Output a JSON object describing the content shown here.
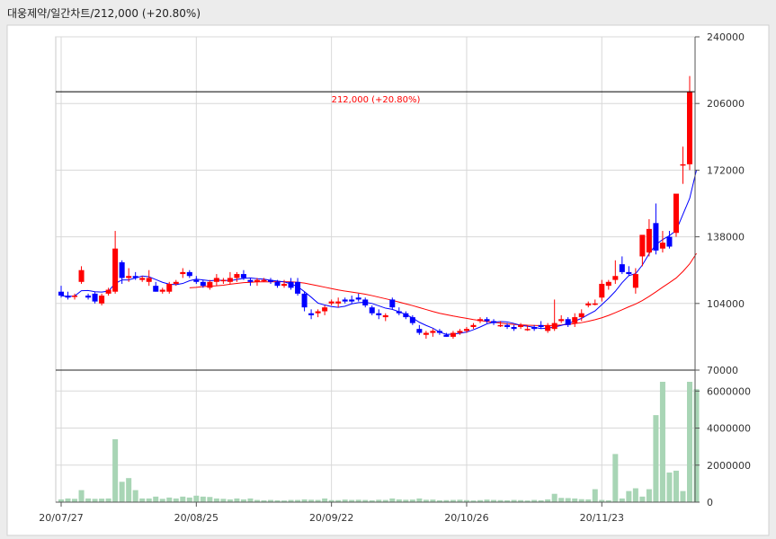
{
  "title": "대웅제약/일간차트/212,000  (+20.80%)",
  "chart_data": [
    {
      "type": "candlestick",
      "name": "price",
      "ylim": [
        70000,
        240000
      ],
      "y_ticks": [
        "240000",
        "206000",
        "172000",
        "138000",
        "104000",
        "70000"
      ],
      "x_ticks": [
        {
          "index": 0,
          "label": "20/07/27"
        },
        {
          "index": 20,
          "label": "20/08/25"
        },
        {
          "index": 40,
          "label": "20/09/22"
        },
        {
          "index": 60,
          "label": "20/10/26"
        },
        {
          "index": 80,
          "label": "20/11/23"
        }
      ],
      "last_price_line": {
        "value": 212000,
        "label": "212,000 (+20.80%)"
      },
      "candles": [
        [
          110000,
          113000,
          107000,
          108000
        ],
        [
          108000,
          110000,
          106000,
          107000
        ],
        [
          108000,
          109000,
          106000,
          108000
        ],
        [
          115000,
          123000,
          114000,
          121000
        ],
        [
          108000,
          109000,
          106000,
          107000
        ],
        [
          109000,
          110000,
          104000,
          105000
        ],
        [
          104000,
          109000,
          103000,
          108000
        ],
        [
          109000,
          112000,
          108000,
          111000
        ],
        [
          110000,
          141000,
          109000,
          132000
        ],
        [
          125000,
          126000,
          114000,
          117000
        ],
        [
          117000,
          122000,
          115000,
          118000
        ],
        [
          118000,
          120000,
          116000,
          117000
        ],
        [
          116000,
          118000,
          115000,
          117000
        ],
        [
          115000,
          121000,
          113000,
          117000
        ],
        [
          113000,
          115000,
          110000,
          110000
        ],
        [
          110000,
          112000,
          109000,
          111000
        ],
        [
          110000,
          115000,
          109000,
          114000
        ],
        [
          114000,
          116000,
          113000,
          115000
        ],
        [
          119000,
          122000,
          117000,
          120000
        ],
        [
          120000,
          121000,
          117000,
          118000
        ],
        [
          116000,
          118000,
          114000,
          115000
        ],
        [
          115000,
          116000,
          112000,
          113000
        ],
        [
          112000,
          116000,
          111000,
          115000
        ],
        [
          115000,
          119000,
          113000,
          117000
        ],
        [
          116000,
          117000,
          114000,
          116000
        ],
        [
          115000,
          120000,
          114000,
          117000
        ],
        [
          117000,
          120000,
          115000,
          119000
        ],
        [
          119000,
          121000,
          116000,
          117000
        ],
        [
          116000,
          117000,
          113000,
          115000
        ],
        [
          115000,
          117000,
          113000,
          116000
        ],
        [
          116000,
          117000,
          115000,
          116000
        ],
        [
          116000,
          117000,
          114000,
          115000
        ],
        [
          115000,
          116000,
          112000,
          113000
        ],
        [
          113000,
          116000,
          112000,
          114000
        ],
        [
          115000,
          117000,
          111000,
          112000
        ],
        [
          115000,
          117000,
          108000,
          109000
        ],
        [
          109000,
          110000,
          100000,
          102000
        ],
        [
          99000,
          101000,
          96000,
          98000
        ],
        [
          99000,
          101000,
          97000,
          100000
        ],
        [
          100000,
          103000,
          98000,
          102000
        ],
        [
          104000,
          106000,
          103000,
          105000
        ],
        [
          104000,
          107000,
          102000,
          105000
        ],
        [
          106000,
          107000,
          104000,
          105000
        ],
        [
          106000,
          108000,
          104000,
          105000
        ],
        [
          107000,
          109000,
          105000,
          106000
        ],
        [
          106000,
          107000,
          102000,
          103000
        ],
        [
          102000,
          103000,
          98000,
          99000
        ],
        [
          99000,
          101000,
          96000,
          98000
        ],
        [
          97000,
          99000,
          95000,
          98000
        ],
        [
          106000,
          107000,
          101000,
          102000
        ],
        [
          100000,
          102000,
          98000,
          99000
        ],
        [
          99000,
          100000,
          96000,
          97000
        ],
        [
          97000,
          98000,
          93000,
          94000
        ],
        [
          91000,
          93000,
          88000,
          89000
        ],
        [
          88000,
          90000,
          86000,
          89000
        ],
        [
          89000,
          91000,
          87000,
          90000
        ],
        [
          90000,
          91000,
          88000,
          89000
        ],
        [
          88000,
          89000,
          87000,
          87000
        ],
        [
          87000,
          90000,
          86000,
          89000
        ],
        [
          89000,
          91000,
          88000,
          90000
        ],
        [
          90000,
          92000,
          89000,
          91000
        ],
        [
          92000,
          94000,
          91000,
          93000
        ],
        [
          95000,
          97000,
          94000,
          96000
        ],
        [
          96000,
          97000,
          94000,
          95000
        ],
        [
          95000,
          96000,
          93000,
          94000
        ],
        [
          93000,
          95000,
          92000,
          93000
        ],
        [
          93000,
          94000,
          91000,
          92000
        ],
        [
          92000,
          93000,
          90000,
          91000
        ],
        [
          92000,
          94000,
          91000,
          93000
        ],
        [
          91000,
          93000,
          90000,
          91000
        ],
        [
          92000,
          93000,
          90000,
          91000
        ],
        [
          93000,
          95000,
          91000,
          92000
        ],
        [
          90000,
          94000,
          89000,
          93000
        ],
        [
          91000,
          106000,
          90000,
          94000
        ],
        [
          95000,
          98000,
          94000,
          96000
        ],
        [
          96000,
          97000,
          92000,
          93000
        ],
        [
          94000,
          99000,
          92000,
          97000
        ],
        [
          97000,
          101000,
          95000,
          99000
        ],
        [
          103000,
          105000,
          102000,
          104000
        ],
        [
          104000,
          106000,
          103000,
          104000
        ],
        [
          107000,
          116000,
          105000,
          114000
        ],
        [
          113000,
          116000,
          111000,
          115000
        ],
        [
          116000,
          126000,
          114000,
          118000
        ],
        [
          124000,
          128000,
          119000,
          120000
        ],
        [
          120000,
          123000,
          118000,
          119000
        ],
        [
          112000,
          122000,
          109000,
          119000
        ],
        [
          128000,
          133000,
          123000,
          139000
        ],
        [
          130000,
          147000,
          128000,
          142000
        ],
        [
          145000,
          155000,
          129000,
          131000
        ],
        [
          132000,
          141000,
          130000,
          135000
        ],
        [
          138000,
          141000,
          132000,
          133000
        ],
        [
          140000,
          145000,
          138000,
          160000
        ],
        [
          175000,
          184000,
          165000,
          175000
        ],
        [
          175000,
          220000,
          172000,
          212000
        ]
      ],
      "ma5": [
        108000,
        107500,
        107800,
        110500,
        110600,
        110000,
        109800,
        110300,
        114200,
        116000,
        116000,
        117000,
        118000,
        117600,
        116200,
        114800,
        113800,
        113600,
        114200,
        115600,
        116400,
        116000,
        115600,
        115800,
        115800,
        115600,
        116200,
        116800,
        117000,
        116600,
        116400,
        115800,
        115400,
        115000,
        114000,
        112600,
        110000,
        107200,
        104200,
        103200,
        102400,
        102000,
        102600,
        103800,
        104400,
        104600,
        104000,
        102800,
        101600,
        101000,
        99800,
        98400,
        96600,
        94400,
        92800,
        91400,
        89400,
        88200,
        88400,
        88800,
        89400,
        90600,
        92000,
        93600,
        94400,
        94800,
        94600,
        93800,
        92800,
        92400,
        91800,
        91200,
        91400,
        92000,
        92800,
        93800,
        95000,
        96400,
        98400,
        100200,
        103400,
        106600,
        110200,
        114600,
        118200,
        119200,
        123600,
        129400,
        134000,
        136600,
        138600,
        141200,
        149400,
        157600,
        172000
      ],
      "ma20": [
        null,
        null,
        null,
        null,
        null,
        null,
        null,
        null,
        null,
        null,
        null,
        null,
        null,
        null,
        null,
        null,
        null,
        null,
        null,
        112000,
        112200,
        112600,
        112800,
        113000,
        113300,
        113800,
        114200,
        114600,
        114800,
        115000,
        115000,
        115000,
        115100,
        115100,
        115000,
        114800,
        114400,
        113700,
        113000,
        112300,
        111600,
        110900,
        110300,
        109800,
        109300,
        108700,
        108000,
        107200,
        106400,
        105600,
        104700,
        103800,
        102900,
        101900,
        100900,
        99900,
        99000,
        98300,
        97600,
        97000,
        96400,
        95800,
        95300,
        94800,
        94400,
        94000,
        93600,
        93300,
        93100,
        92900,
        92800,
        92700,
        92700,
        92800,
        93000,
        93300,
        93700,
        94200,
        94900,
        95700,
        96700,
        97900,
        99300,
        100800,
        102300,
        103700,
        105500,
        107600,
        109900,
        112300,
        114600,
        117000,
        120300,
        124200,
        129500
      ],
      "colors": {
        "up": "#ff0000",
        "down": "#0000ff",
        "ma5": "#0000ff",
        "ma20": "#ff0000",
        "last_line": "#000000"
      }
    },
    {
      "type": "bar",
      "name": "volume",
      "ylim": [
        0,
        6500000
      ],
      "y_ticks": [
        "6000000",
        "4000000",
        "2000000",
        "0"
      ],
      "values": [
        150000,
        200000,
        180000,
        650000,
        200000,
        180000,
        190000,
        200000,
        3400000,
        1100000,
        1300000,
        650000,
        200000,
        200000,
        300000,
        180000,
        250000,
        200000,
        300000,
        250000,
        350000,
        300000,
        280000,
        200000,
        180000,
        150000,
        200000,
        150000,
        200000,
        120000,
        100000,
        120000,
        100000,
        90000,
        120000,
        120000,
        150000,
        130000,
        120000,
        200000,
        110000,
        110000,
        140000,
        120000,
        130000,
        120000,
        100000,
        130000,
        120000,
        200000,
        150000,
        130000,
        140000,
        200000,
        130000,
        140000,
        100000,
        110000,
        120000,
        130000,
        110000,
        90000,
        110000,
        140000,
        120000,
        110000,
        100000,
        120000,
        110000,
        90000,
        120000,
        100000,
        150000,
        450000,
        230000,
        220000,
        200000,
        160000,
        150000,
        700000,
        120000,
        100000,
        2600000,
        200000,
        600000,
        750000,
        300000,
        700000,
        4700000,
        6500000,
        1600000,
        1700000,
        600000,
        6500000,
        6100000
      ],
      "color": "#a8d5b5"
    }
  ]
}
